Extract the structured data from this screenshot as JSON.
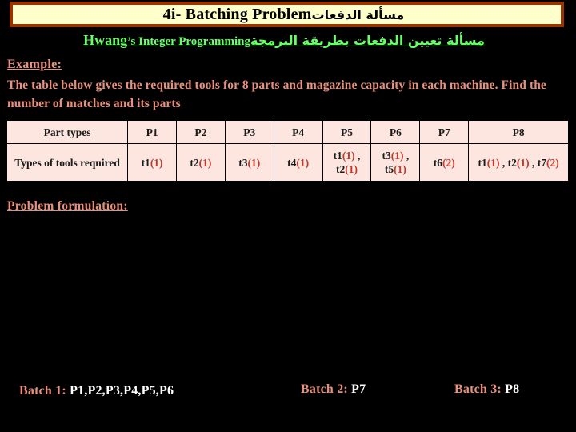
{
  "slide": {
    "title": {
      "english": "4i- Batching Problem",
      "arabic": "مسألة الدفعات"
    },
    "subtitle": {
      "english_lead": "Hwang",
      "english_rest": "’s Integer Programming",
      "arabic": "مسألة تعيين الدفعات بطريقة البرمجة"
    },
    "example": {
      "heading": "Example:",
      "body": "The table below gives the required tools for 8 parts and magazine capacity in each machine. Find the number of matches and its parts"
    },
    "table": {
      "row_label_header": "Part types",
      "row_label_data": "Types of tools required",
      "columns": [
        "P1",
        "P2",
        "P3",
        "P4",
        "P5",
        "P6",
        "P7",
        "P8"
      ],
      "cells": [
        [
          {
            "tool": "t1",
            "qty": "(1)"
          }
        ],
        [
          {
            "tool": "t2",
            "qty": "(1)"
          }
        ],
        [
          {
            "tool": "t3",
            "qty": "(1)"
          }
        ],
        [
          {
            "tool": "t4",
            "qty": "(1)"
          }
        ],
        [
          {
            "tool": "t1",
            "qty": "(1)",
            "sep": " ,"
          },
          {
            "tool": "t2",
            "qty": "(1)"
          }
        ],
        [
          {
            "tool": "t3",
            "qty": "(1)",
            "sep": " ,"
          },
          {
            "tool": "t5",
            "qty": "(1)"
          }
        ],
        [
          {
            "tool": "t6",
            "qty": "(2)"
          }
        ],
        [
          {
            "tool": "t1",
            "qty": "(1)",
            "sep": " ,"
          },
          {
            "tool": "t2",
            "qty": "(1)",
            "sep": " ,"
          },
          {
            "tool": "t7",
            "qty": "(2)"
          }
        ]
      ]
    },
    "formulation_heading": "Problem formulation:",
    "batches": [
      {
        "label": "Batch 1:",
        "parts": "P1,P2,P3,P4,P5,P6"
      },
      {
        "label": "Batch 2:",
        "parts": "P7"
      },
      {
        "label": "Batch 3:",
        "parts": "P8"
      }
    ]
  },
  "colors": {
    "background": "#000000",
    "title_fill": "#FFFFCC",
    "title_border": "#993300",
    "accent_green": "#66FF66",
    "accent_salmon": "#E8907B",
    "table_cell": "#FCE6DF",
    "qty_red": "#C0392B"
  }
}
